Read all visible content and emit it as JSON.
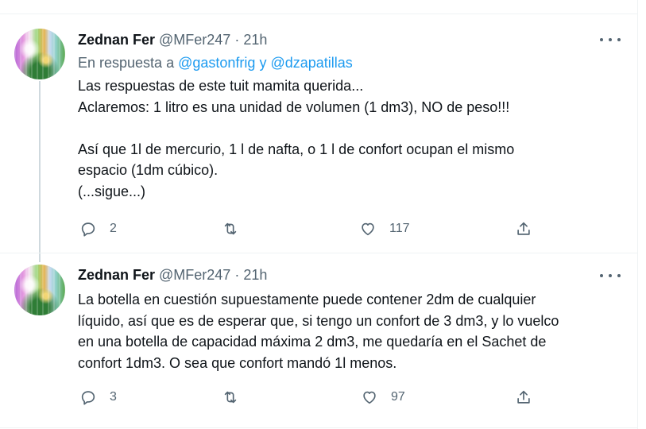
{
  "tweets": [
    {
      "author_name": "Zednan Fer",
      "author_handle": "@MFer247",
      "separator": "·",
      "time": "21h",
      "reply_prefix": "En respuesta a",
      "reply_user_1": "@gastonfrig",
      "reply_conjunction": "y",
      "reply_user_2": "@dzapatillas",
      "lines": [
        "Las respuestas de este tuit mamita querida...",
        "Aclaremos: 1 litro es una unidad de volumen (1 dm3), NO de peso!!!",
        "",
        "Así que 1l de mercurio, 1 l de nafta, o 1 l de confort ocupan el mismo",
        "espacio (1dm cúbico).",
        "(...sigue...)"
      ],
      "reply_count": "2",
      "retweet_count": "",
      "like_count": "117"
    },
    {
      "author_name": "Zednan Fer",
      "author_handle": "@MFer247",
      "separator": "·",
      "time": "21h",
      "lines": [
        "La botella en cuestión supuestamente puede contener 2dm de cualquier",
        "líquido, así que es de esperar que, si tengo un confort de 3 dm3, y lo vuelco",
        "en una botella de capacidad máxima 2 dm3, me quedaría en el Sachet de",
        "confort 1dm3. O sea que confort mandó 1l menos."
      ],
      "reply_count": "3",
      "retweet_count": "",
      "like_count": "97"
    }
  ],
  "icons": {
    "avatar": "avatar-image",
    "reply": "speech-bubble-icon",
    "retweet": "retweet-arrows-icon",
    "like": "heart-icon",
    "share": "upload-share-icon",
    "more": "more-dots-icon"
  },
  "colors": {
    "link": "#1d9bf0",
    "muted": "#536471",
    "text": "#0f1419",
    "border": "#eff3f4"
  }
}
